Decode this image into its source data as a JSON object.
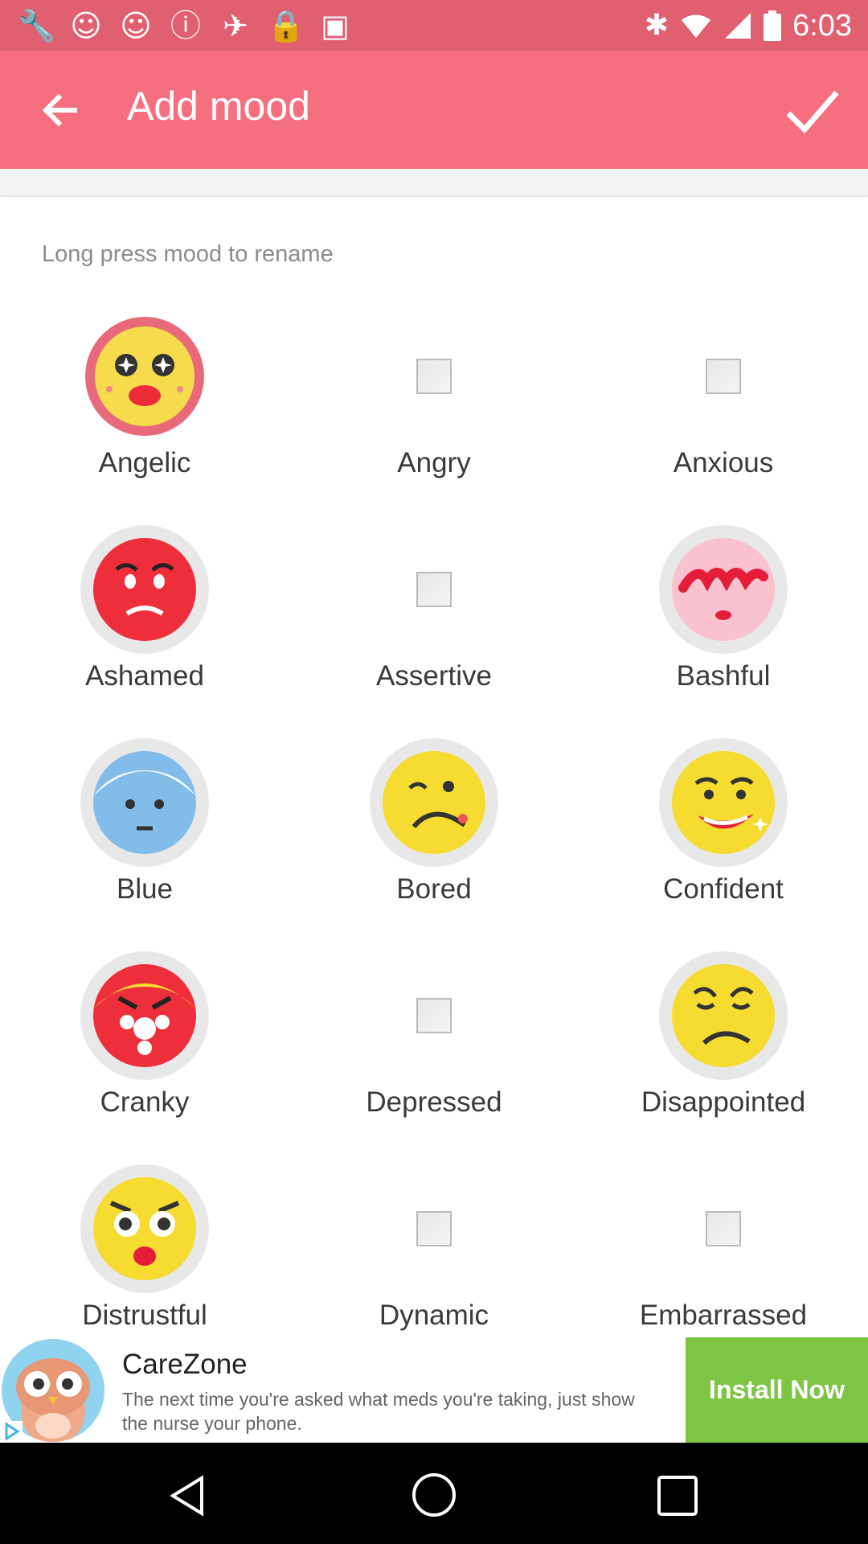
{
  "status_bar": {
    "time": "6:03",
    "left_icons": [
      "wrench-icon",
      "smiley-icon",
      "smiley-icon",
      "exclamation-icon",
      "satellite-icon",
      "lock-icon",
      "android-icon"
    ],
    "right_icons": [
      "bluetooth-icon",
      "wifi-icon",
      "signal-icon",
      "battery-icon"
    ]
  },
  "toolbar": {
    "title": "Add mood"
  },
  "hint": "Long press mood to rename",
  "moods": [
    {
      "label": "Angelic",
      "kind": "emoji",
      "face": "angelic"
    },
    {
      "label": "Angry",
      "kind": "placeholder"
    },
    {
      "label": "Anxious",
      "kind": "placeholder"
    },
    {
      "label": "Ashamed",
      "kind": "emoji",
      "face": "ashamed"
    },
    {
      "label": "Assertive",
      "kind": "placeholder"
    },
    {
      "label": "Bashful",
      "kind": "emoji",
      "face": "bashful"
    },
    {
      "label": "Blue",
      "kind": "emoji",
      "face": "blue"
    },
    {
      "label": "Bored",
      "kind": "emoji",
      "face": "bored"
    },
    {
      "label": "Confident",
      "kind": "emoji",
      "face": "confident"
    },
    {
      "label": "Cranky",
      "kind": "emoji",
      "face": "cranky"
    },
    {
      "label": "Depressed",
      "kind": "placeholder"
    },
    {
      "label": "Disappointed",
      "kind": "emoji",
      "face": "disappointed"
    },
    {
      "label": "Distrustful",
      "kind": "emoji",
      "face": "distrustful"
    },
    {
      "label": "Dynamic",
      "kind": "placeholder"
    },
    {
      "label": "Embarrassed",
      "kind": "placeholder"
    }
  ],
  "ad": {
    "name": "CareZone",
    "text": "The next time you're asked what meds you're taking, just show the nurse your phone.",
    "cta": "Install Now"
  },
  "colors": {
    "toolbar": "#f66f7e",
    "status_bar": "#e0606f",
    "install": "#7dc543"
  }
}
